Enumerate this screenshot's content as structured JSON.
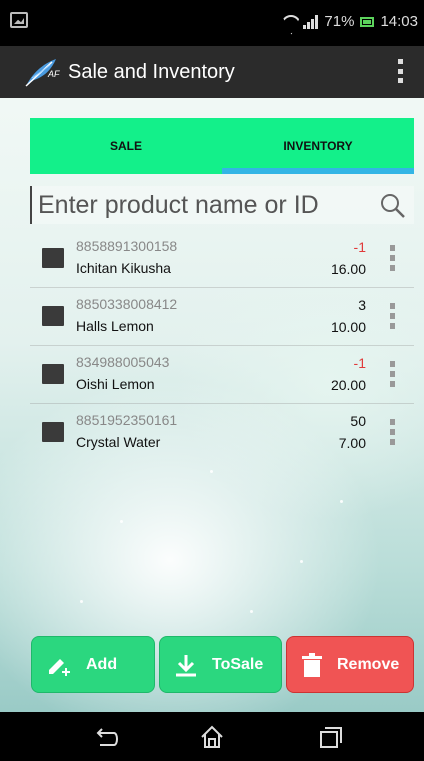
{
  "status_bar": {
    "battery": "71%",
    "time": "14:03"
  },
  "app": {
    "title": "Sale and Inventory"
  },
  "tabs": [
    {
      "label": "SALE",
      "active": false
    },
    {
      "label": "INVENTORY",
      "active": true
    }
  ],
  "search": {
    "placeholder": "Enter product name or ID",
    "value": ""
  },
  "products": [
    {
      "id": "8858891300158",
      "name": "Ichitan Kikusha",
      "qty": "-1",
      "price": "16.00"
    },
    {
      "id": "8850338008412",
      "name": "Halls Lemon",
      "qty": "3",
      "price": "10.00"
    },
    {
      "id": "834988005043",
      "name": "Oishi Lemon",
      "qty": "-1",
      "price": "20.00"
    },
    {
      "id": "8851952350161",
      "name": "Crystal Water",
      "qty": "50",
      "price": "7.00"
    }
  ],
  "buttons": {
    "add": "Add",
    "to_sale": "ToSale",
    "remove": "Remove"
  },
  "colors": {
    "accent_green": "#13f08a",
    "tab_indicator": "#33b5e5",
    "negative_qty": "#e03a3a",
    "remove_red": "#f05454"
  },
  "icons": {
    "app": "feather-icon",
    "search": "search-icon",
    "add": "pencil-plus-icon",
    "to_sale": "download-icon",
    "remove": "trash-icon",
    "nav_back": "back-icon",
    "nav_home": "home-icon",
    "nav_recents": "recents-icon"
  }
}
